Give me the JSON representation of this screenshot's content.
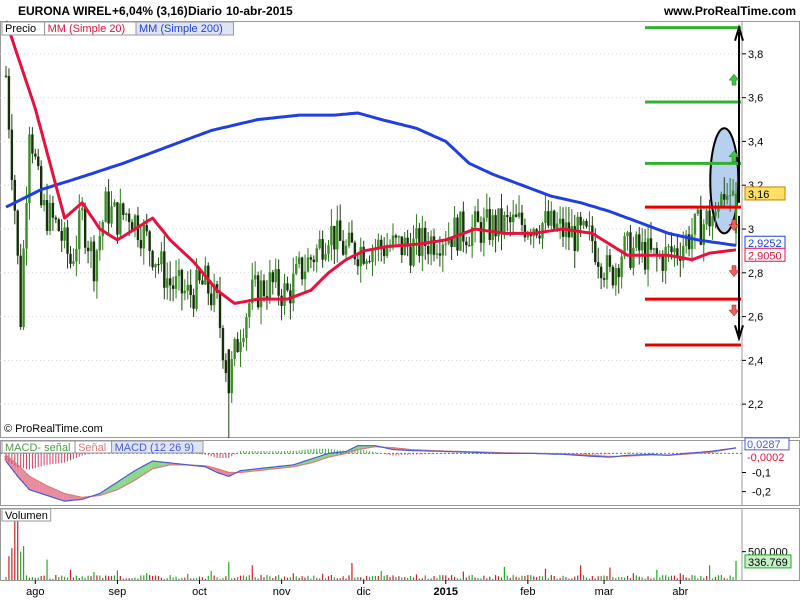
{
  "header": {
    "symbol": "EURONA WIREL",
    "change": "+6,04% (3,16)",
    "period": "Diario",
    "date": "10-abr-2015",
    "site": "www.ProRealTime.com"
  },
  "copyright": "© ProRealTime.com",
  "colors": {
    "up": "#2f7a1f",
    "down": "#1f3f12",
    "ma20": "#e8103c",
    "ma200": "#1f3fe0",
    "green_level": "#33b033",
    "red_level": "#e80000",
    "macd_line": "#4a5ad8",
    "signal_line": "#e07a7a",
    "hist_up": "#8ad88a",
    "hist_down": "#e88aa0",
    "highlight": "#b8d0f0"
  },
  "chart_data": [
    {
      "type": "candlestick",
      "name": "price",
      "legend": [
        "Precio",
        "MM (Simple 20)",
        "MM (Simple 200)"
      ],
      "ylim": [
        2.05,
        3.95
      ],
      "yticks": [
        2.2,
        2.4,
        2.6,
        2.8,
        3.0,
        3.2,
        3.4,
        3.6,
        3.8
      ],
      "ytick_labels": [
        "2,2",
        "2,4",
        "2,6",
        "2,8",
        "3",
        "3,2",
        "3,4",
        "3,6",
        "3,8"
      ],
      "x_labels": [
        "ago",
        "sep",
        "oct",
        "nov",
        "dic",
        "2015",
        "feb",
        "mar",
        "abr"
      ],
      "x_label_index": [
        10,
        38,
        66,
        94,
        122,
        150,
        178,
        204,
        230
      ],
      "n": 250,
      "anchors": [
        [
          0,
          3.7
        ],
        [
          3,
          3.1
        ],
        [
          5,
          2.6
        ],
        [
          8,
          3.5
        ],
        [
          12,
          3.1
        ],
        [
          18,
          3.0
        ],
        [
          22,
          2.85
        ],
        [
          26,
          3.05
        ],
        [
          30,
          2.85
        ],
        [
          34,
          3.1
        ],
        [
          38,
          3.05
        ],
        [
          42,
          3.08
        ],
        [
          46,
          3.0
        ],
        [
          50,
          2.9
        ],
        [
          56,
          2.75
        ],
        [
          62,
          2.7
        ],
        [
          68,
          2.75
        ],
        [
          72,
          2.65
        ],
        [
          76,
          2.3
        ],
        [
          80,
          2.55
        ],
        [
          84,
          2.7
        ],
        [
          90,
          2.75
        ],
        [
          96,
          2.7
        ],
        [
          100,
          2.8
        ],
        [
          106,
          2.9
        ],
        [
          110,
          3.0
        ],
        [
          116,
          2.9
        ],
        [
          124,
          2.92
        ],
        [
          132,
          2.92
        ],
        [
          140,
          2.92
        ],
        [
          150,
          2.98
        ],
        [
          160,
          3.0
        ],
        [
          172,
          3.02
        ],
        [
          182,
          3.03
        ],
        [
          192,
          2.98
        ],
        [
          200,
          2.95
        ],
        [
          206,
          2.78
        ],
        [
          210,
          2.9
        ],
        [
          216,
          2.9
        ],
        [
          222,
          2.86
        ],
        [
          228,
          2.9
        ],
        [
          234,
          2.98
        ],
        [
          240,
          3.05
        ],
        [
          244,
          3.15
        ],
        [
          249,
          3.16
        ]
      ],
      "ma20_anchors": [
        [
          0,
          3.95
        ],
        [
          10,
          3.55
        ],
        [
          20,
          3.05
        ],
        [
          26,
          3.12
        ],
        [
          32,
          3.0
        ],
        [
          38,
          2.95
        ],
        [
          44,
          3.0
        ],
        [
          50,
          3.05
        ],
        [
          56,
          2.95
        ],
        [
          64,
          2.85
        ],
        [
          72,
          2.72
        ],
        [
          78,
          2.66
        ],
        [
          86,
          2.68
        ],
        [
          96,
          2.68
        ],
        [
          104,
          2.72
        ],
        [
          110,
          2.8
        ],
        [
          116,
          2.86
        ],
        [
          122,
          2.9
        ],
        [
          130,
          2.92
        ],
        [
          140,
          2.93
        ],
        [
          150,
          2.95
        ],
        [
          160,
          3.0
        ],
        [
          170,
          2.98
        ],
        [
          180,
          2.98
        ],
        [
          190,
          3.0
        ],
        [
          200,
          2.98
        ],
        [
          206,
          2.93
        ],
        [
          212,
          2.88
        ],
        [
          218,
          2.88
        ],
        [
          226,
          2.88
        ],
        [
          234,
          2.86
        ],
        [
          240,
          2.89
        ],
        [
          249,
          2.905
        ]
      ],
      "ma200_anchors": [
        [
          0,
          3.1
        ],
        [
          12,
          3.18
        ],
        [
          24,
          3.23
        ],
        [
          40,
          3.3
        ],
        [
          56,
          3.38
        ],
        [
          70,
          3.45
        ],
        [
          86,
          3.5
        ],
        [
          100,
          3.52
        ],
        [
          112,
          3.52
        ],
        [
          120,
          3.53
        ],
        [
          128,
          3.5
        ],
        [
          140,
          3.46
        ],
        [
          150,
          3.4
        ],
        [
          158,
          3.3
        ],
        [
          166,
          3.25
        ],
        [
          176,
          3.2
        ],
        [
          186,
          3.15
        ],
        [
          196,
          3.12
        ],
        [
          206,
          3.08
        ],
        [
          216,
          3.03
        ],
        [
          226,
          2.98
        ],
        [
          236,
          2.95
        ],
        [
          249,
          2.925
        ]
      ],
      "last_price": "3,16",
      "ma200_last": "2,9252",
      "ma20_last": "2,9050",
      "green_levels": [
        3.92,
        3.58,
        3.3
      ],
      "red_levels": [
        3.1,
        2.68,
        2.47
      ],
      "green_arrow_levels": [
        3.68,
        3.33
      ],
      "red_arrow_levels": [
        3.02,
        2.81,
        2.63
      ]
    },
    {
      "type": "macd",
      "legend": [
        "MACD- señal",
        "Señal",
        "MACD (12 26 9)"
      ],
      "ylim": [
        -0.27,
        0.07
      ],
      "yticks": [
        -0.1,
        -0.2
      ],
      "ytick_labels": [
        "-0,1",
        "-0,2"
      ],
      "macd_last": "0,0287",
      "diff_last": "-0,0002",
      "macd_anchors": [
        [
          0,
          -0.04
        ],
        [
          4,
          -0.12
        ],
        [
          8,
          -0.19
        ],
        [
          14,
          -0.22
        ],
        [
          20,
          -0.25
        ],
        [
          26,
          -0.24
        ],
        [
          32,
          -0.21
        ],
        [
          38,
          -0.15
        ],
        [
          44,
          -0.09
        ],
        [
          50,
          -0.04
        ],
        [
          56,
          -0.05
        ],
        [
          62,
          -0.06
        ],
        [
          68,
          -0.07
        ],
        [
          72,
          -0.1
        ],
        [
          76,
          -0.12
        ],
        [
          80,
          -0.09
        ],
        [
          86,
          -0.08
        ],
        [
          92,
          -0.07
        ],
        [
          98,
          -0.06
        ],
        [
          104,
          -0.03
        ],
        [
          110,
          0.0
        ],
        [
          116,
          0.01
        ],
        [
          120,
          0.04
        ],
        [
          126,
          0.04
        ],
        [
          132,
          0.02
        ],
        [
          138,
          0.015
        ],
        [
          150,
          0.01
        ],
        [
          160,
          0.005
        ],
        [
          170,
          0.0
        ],
        [
          180,
          0.0
        ],
        [
          190,
          -0.005
        ],
        [
          200,
          -0.015
        ],
        [
          206,
          -0.02
        ],
        [
          212,
          -0.01
        ],
        [
          220,
          -0.005
        ],
        [
          226,
          -0.01
        ],
        [
          232,
          0.0
        ],
        [
          240,
          0.01
        ],
        [
          249,
          0.0287
        ]
      ],
      "signal_anchors": [
        [
          0,
          -0.01
        ],
        [
          4,
          -0.06
        ],
        [
          8,
          -0.12
        ],
        [
          14,
          -0.17
        ],
        [
          20,
          -0.21
        ],
        [
          26,
          -0.23
        ],
        [
          32,
          -0.22
        ],
        [
          38,
          -0.19
        ],
        [
          44,
          -0.14
        ],
        [
          50,
          -0.08
        ],
        [
          56,
          -0.06
        ],
        [
          62,
          -0.06
        ],
        [
          68,
          -0.065
        ],
        [
          72,
          -0.08
        ],
        [
          76,
          -0.1
        ],
        [
          80,
          -0.1
        ],
        [
          86,
          -0.09
        ],
        [
          92,
          -0.08
        ],
        [
          98,
          -0.07
        ],
        [
          104,
          -0.05
        ],
        [
          110,
          -0.02
        ],
        [
          116,
          0.0
        ],
        [
          120,
          0.02
        ],
        [
          126,
          0.035
        ],
        [
          132,
          0.03
        ],
        [
          138,
          0.02
        ],
        [
          150,
          0.012
        ],
        [
          160,
          0.008
        ],
        [
          170,
          0.003
        ],
        [
          180,
          0.0
        ],
        [
          190,
          -0.002
        ],
        [
          200,
          -0.01
        ],
        [
          206,
          -0.016
        ],
        [
          212,
          -0.014
        ],
        [
          220,
          -0.008
        ],
        [
          226,
          -0.009
        ],
        [
          232,
          -0.004
        ],
        [
          240,
          0.005
        ],
        [
          249,
          0.0289
        ]
      ]
    },
    {
      "type": "volume",
      "legend": [
        "Volumen"
      ],
      "yticks": [
        500000
      ],
      "ytick_labels": [
        "500.000"
      ],
      "ymax": 1200000,
      "volume_last": "336.769",
      "spikes": [
        [
          1,
          420000
        ],
        [
          2,
          560000
        ],
        [
          3,
          1150000
        ],
        [
          4,
          1050000
        ],
        [
          5,
          500000
        ],
        [
          6,
          600000
        ],
        [
          14,
          360000
        ],
        [
          22,
          180000
        ],
        [
          30,
          140000
        ],
        [
          38,
          170000
        ],
        [
          48,
          120000
        ],
        [
          62,
          110000
        ],
        [
          70,
          160000
        ],
        [
          76,
          320000
        ],
        [
          84,
          260000
        ],
        [
          98,
          120000
        ],
        [
          108,
          110000
        ],
        [
          118,
          300000
        ],
        [
          128,
          160000
        ],
        [
          140,
          100000
        ],
        [
          156,
          150000
        ],
        [
          170,
          230000
        ],
        [
          184,
          200000
        ],
        [
          196,
          260000
        ],
        [
          206,
          220000
        ],
        [
          214,
          120000
        ],
        [
          222,
          180000
        ],
        [
          230,
          120000
        ],
        [
          240,
          260000
        ],
        [
          249,
          336769
        ]
      ]
    }
  ]
}
